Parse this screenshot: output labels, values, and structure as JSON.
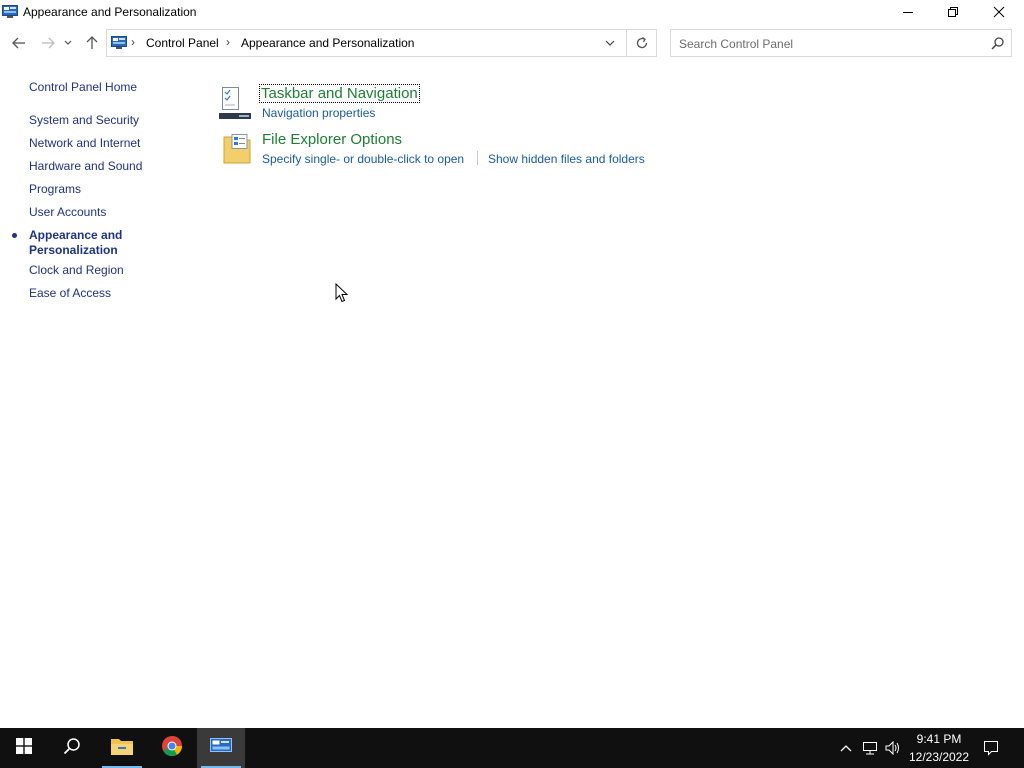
{
  "window": {
    "title": "Appearance and Personalization"
  },
  "address_bar": {
    "crumbs": [
      "Control Panel",
      "Appearance and Personalization"
    ]
  },
  "search": {
    "placeholder": "Search Control Panel"
  },
  "left_nav": {
    "home": "Control Panel Home",
    "items": [
      "System and Security",
      "Network and Internet",
      "Hardware and Sound",
      "Programs",
      "User Accounts",
      "Appearance and Personalization",
      "Clock and Region",
      "Ease of Access"
    ],
    "current_index": 5
  },
  "categories": [
    {
      "title": "Taskbar and Navigation",
      "icon": "taskbar-navigation-icon",
      "tasks": [
        "Navigation properties"
      ]
    },
    {
      "title": "File Explorer Options",
      "icon": "file-explorer-options-icon",
      "tasks": [
        "Specify single- or double-click to open",
        "Show hidden files and folders"
      ]
    }
  ],
  "taskbar": {
    "buttons": [
      "start-icon",
      "search-icon",
      "file-explorer-icon",
      "chrome-icon",
      "control-panel-icon"
    ],
    "tray": [
      "chevron-up-icon",
      "network-icon",
      "volume-icon"
    ],
    "time": "9:41 PM",
    "date": "12/23/2022",
    "notification_icon": "action-center-icon"
  },
  "colors": {
    "category_green": "#1e7e34",
    "link_blue": "#1a5aa8",
    "nav_blue": "#1e3287",
    "taskbar": "#101010"
  }
}
